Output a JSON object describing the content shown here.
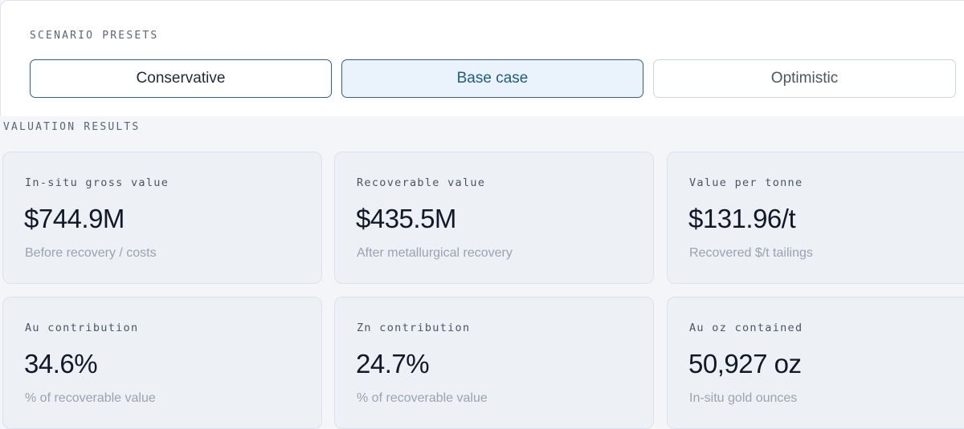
{
  "presets": {
    "label": "SCENARIO PRESETS",
    "options": [
      {
        "label": "Conservative"
      },
      {
        "label": "Base case"
      },
      {
        "label": "Optimistic"
      }
    ],
    "selected": "Base case"
  },
  "results": {
    "label": "VALUATION RESULTS",
    "cards": [
      {
        "title": "In-situ gross value",
        "value": "$744.9M",
        "sub": "Before recovery / costs"
      },
      {
        "title": "Recoverable value",
        "value": "$435.5M",
        "sub": "After metallurgical recovery"
      },
      {
        "title": "Value per tonne",
        "value": "$131.96/t",
        "sub": "Recovered $/t tailings"
      },
      {
        "title": "Au contribution",
        "value": "34.6%",
        "sub": "% of recoverable value"
      },
      {
        "title": "Zn contribution",
        "value": "24.7%",
        "sub": "% of recoverable value"
      },
      {
        "title": "Au oz contained",
        "value": "50,927 oz",
        "sub": "In-situ gold ounces"
      }
    ]
  },
  "colors": {
    "accent": "#2f6286",
    "selected_bg": "#eaf3fc",
    "card_bg": "#edf0f4",
    "page_bg": "#f3f5f8"
  }
}
